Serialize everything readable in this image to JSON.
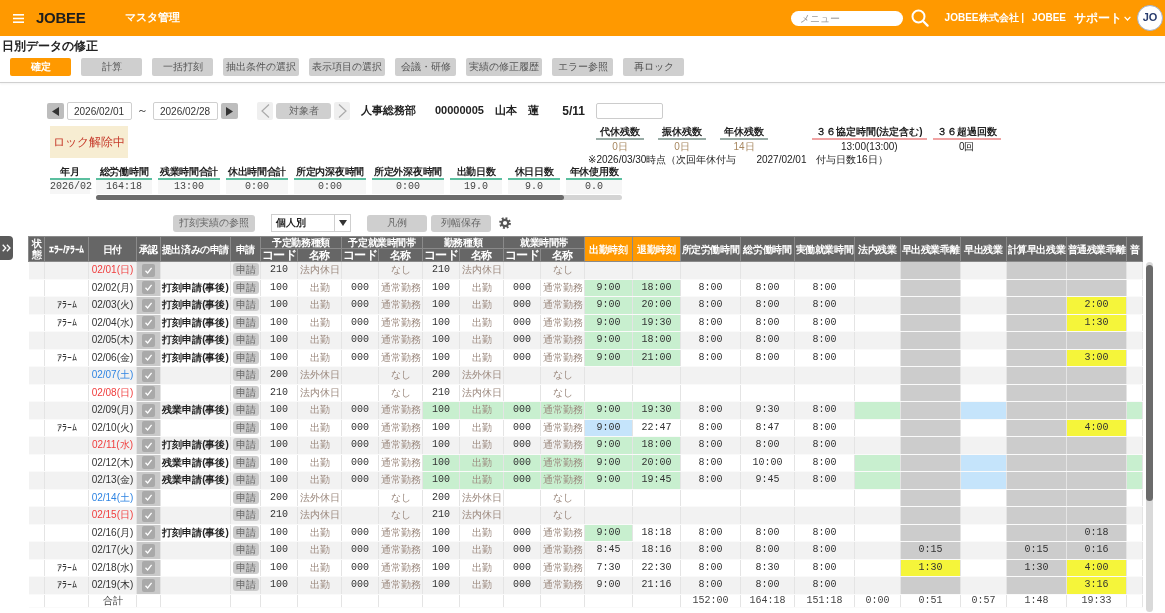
{
  "header": {
    "logo": "JOBEE",
    "section": "マスタ管理",
    "search": {
      "placeholder": "メニュー"
    },
    "company": "JOBEE株式会社 |",
    "user": "JOBEE",
    "support": "サポート",
    "avatar": "JO"
  },
  "page_title": "日別データの修正",
  "toolbar": [
    {
      "label": "確定",
      "kind": "primary"
    },
    {
      "label": "計算",
      "kind": "secondary"
    },
    {
      "label": "一括打刻",
      "kind": "secondary"
    },
    {
      "label": "抽出条件の選択",
      "kind": "secondary"
    },
    {
      "label": "表示項目の選択",
      "kind": "secondary"
    },
    {
      "label": "会議・研修",
      "kind": "secondary"
    },
    {
      "label": "実績の修正履歴",
      "kind": "secondary"
    },
    {
      "label": "エラー参照",
      "kind": "secondary"
    },
    {
      "label": "再ロック",
      "kind": "secondary"
    }
  ],
  "period": {
    "from": "2026/02/01",
    "separator": "～",
    "to": "2026/02/28"
  },
  "target": {
    "button": "対象者",
    "department": "人事総務部",
    "code": "00000005",
    "name": "山本　蓮",
    "position": "5/11"
  },
  "lock_status": "ロック解除中",
  "summary": [
    {
      "label": "年月",
      "value": "2026/02"
    },
    {
      "label": "総労働時間",
      "value": "164:18"
    },
    {
      "label": "残業時間合計",
      "value": "13:00"
    },
    {
      "label": "休出時間合計",
      "value": "0:00"
    },
    {
      "label": "所定内深夜時間",
      "value": "0:00"
    },
    {
      "label": "所定外深夜時間",
      "value": "0:00"
    },
    {
      "label": "出勤日数",
      "value": "19.0"
    },
    {
      "label": "休日日数",
      "value": "9.0"
    },
    {
      "label": "年休使用数",
      "value": "0.0"
    }
  ],
  "balances": {
    "items": [
      {
        "label": "代休残数",
        "value": "0日",
        "kind": "leave"
      },
      {
        "label": "振休残数",
        "value": "0日",
        "kind": "leave"
      },
      {
        "label": "年休残数",
        "value": "14日",
        "kind": "leave"
      },
      {
        "label": "３６協定時間(法定含む)",
        "value": "13:00(13:00)",
        "kind": "limit"
      },
      {
        "label": "３６超過回数",
        "value": "0回",
        "kind": "limit"
      }
    ],
    "note": "※2026/03/30時点（次回年休付与　　2027/02/01　付与日数16日）"
  },
  "table_tools": {
    "reference_button": "打刻実績の参照",
    "view_select": "個人別",
    "legend_button": "凡例",
    "save_widths_button": "列幅保存"
  },
  "table": {
    "columns": [
      {
        "label": "状態",
        "kind": "label"
      },
      {
        "label": "ｴﾗｰ/ｱﾗｰﾑ",
        "kind": "label"
      },
      {
        "label": "日付",
        "kind": "label"
      },
      {
        "label": "承認",
        "kind": "label"
      },
      {
        "label": "提出済みの申請",
        "kind": "label"
      },
      {
        "label": "申請",
        "kind": "label"
      },
      {
        "label": "予定勤務種類",
        "kind": "group",
        "subcolumns": [
          {
            "label": "コード",
            "kind": "code"
          },
          {
            "label": "名称",
            "kind": "name"
          }
        ]
      },
      {
        "label": "予定就業時間帯",
        "kind": "group",
        "subcolumns": [
          {
            "label": "コード",
            "kind": "code"
          },
          {
            "label": "名称",
            "kind": "name"
          }
        ]
      },
      {
        "label": "勤務種類",
        "kind": "group",
        "subcolumns": [
          {
            "label": "コード",
            "kind": "code"
          },
          {
            "label": "名称",
            "kind": "name"
          }
        ]
      },
      {
        "label": "就業時間帯",
        "kind": "group",
        "subcolumns": [
          {
            "label": "コード",
            "kind": "code"
          },
          {
            "label": "名称",
            "kind": "name"
          }
        ]
      },
      {
        "label": "出勤時刻",
        "kind": "time",
        "accent": true,
        "shaded": false
      },
      {
        "label": "退勤時刻",
        "kind": "time",
        "accent": true,
        "shaded": false
      },
      {
        "label": "所定労働時間",
        "kind": "time",
        "accent": false,
        "shaded": false
      },
      {
        "label": "総労働時間",
        "kind": "time",
        "accent": false,
        "shaded": false
      },
      {
        "label": "実働就業時間",
        "kind": "time",
        "accent": false,
        "shaded": false
      },
      {
        "label": "法内残業",
        "kind": "time",
        "accent": false,
        "shaded": false
      },
      {
        "label": "早出残業乖離",
        "kind": "time",
        "accent": false,
        "shaded": true
      },
      {
        "label": "早出残業",
        "kind": "time",
        "accent": false,
        "shaded": false
      },
      {
        "label": "計算早出残業",
        "kind": "time",
        "accent": false,
        "shaded": true
      },
      {
        "label": "普通残業乖離",
        "kind": "time",
        "accent": false,
        "shaded": true
      },
      {
        "label": "普",
        "kind": "time",
        "accent": false,
        "shaded": false
      }
    ],
    "rows": [
      {
        "kind": "holiday",
        "date": "02/01(日)",
        "approved": true,
        "apply": "申請",
        "planned_work_type": {
          "code": "210",
          "name": "法内休日"
        },
        "planned_work_hours": {
          "name": "なし"
        },
        "work_type": {
          "code": "210",
          "name": "法内休日"
        },
        "work_hours": {
          "name": "なし"
        }
      },
      {
        "kind": "weekday",
        "date": "02/02(月)",
        "approved": true,
        "request": "打刻申請(事後)",
        "apply": "申請",
        "planned_work_type": {
          "code": "100",
          "name": "出勤"
        },
        "planned_work_hours": {
          "code": "000",
          "name": "通常勤務"
        },
        "work_type": {
          "code": "100",
          "name": "出勤"
        },
        "work_hours": {
          "code": "000",
          "name": "通常勤務"
        },
        "clock_in": {
          "text": "9:00",
          "color": "#c8efcf"
        },
        "clock_out": {
          "text": "18:00",
          "color": "#c8efcf"
        },
        "scheduled_hours": "8:00",
        "total_hours": "8:00",
        "actual_hours": "8:00"
      },
      {
        "kind": "weekday",
        "alarm": "ｱﾗｰﾑ",
        "date": "02/03(火)",
        "approved": true,
        "request": "打刻申請(事後)",
        "apply": "申請",
        "planned_work_type": {
          "code": "100",
          "name": "出勤"
        },
        "planned_work_hours": {
          "code": "000",
          "name": "通常勤務"
        },
        "work_type": {
          "code": "100",
          "name": "出勤"
        },
        "work_hours": {
          "code": "000",
          "name": "通常勤務"
        },
        "clock_in": {
          "text": "9:00",
          "color": "#c8efcf"
        },
        "clock_out": {
          "text": "20:00",
          "color": "#c8efcf"
        },
        "scheduled_hours": "8:00",
        "total_hours": "8:00",
        "actual_hours": "8:00",
        "overtime_gap": {
          "text": "2:00",
          "color": "#f5f53a"
        }
      },
      {
        "kind": "weekday",
        "alarm": "ｱﾗｰﾑ",
        "date": "02/04(水)",
        "approved": true,
        "request": "打刻申請(事後)",
        "apply": "申請",
        "planned_work_type": {
          "code": "100",
          "name": "出勤"
        },
        "planned_work_hours": {
          "code": "000",
          "name": "通常勤務"
        },
        "work_type": {
          "code": "100",
          "name": "出勤"
        },
        "work_hours": {
          "code": "000",
          "name": "通常勤務"
        },
        "clock_in": {
          "text": "9:00",
          "color": "#c8efcf"
        },
        "clock_out": {
          "text": "19:30",
          "color": "#c8efcf"
        },
        "scheduled_hours": "8:00",
        "total_hours": "8:00",
        "actual_hours": "8:00",
        "overtime_gap": {
          "text": "1:30",
          "color": "#f5f53a"
        }
      },
      {
        "kind": "weekday",
        "date": "02/05(木)",
        "approved": true,
        "request": "打刻申請(事後)",
        "apply": "申請",
        "planned_work_type": {
          "code": "100",
          "name": "出勤"
        },
        "planned_work_hours": {
          "code": "000",
          "name": "通常勤務"
        },
        "work_type": {
          "code": "100",
          "name": "出勤"
        },
        "work_hours": {
          "code": "000",
          "name": "通常勤務"
        },
        "clock_in": {
          "text": "9:00",
          "color": "#c8efcf"
        },
        "clock_out": {
          "text": "18:00",
          "color": "#c8efcf"
        },
        "scheduled_hours": "8:00",
        "total_hours": "8:00",
        "actual_hours": "8:00"
      },
      {
        "kind": "weekday",
        "alarm": "ｱﾗｰﾑ",
        "date": "02/06(金)",
        "approved": true,
        "request": "打刻申請(事後)",
        "apply": "申請",
        "planned_work_type": {
          "code": "100",
          "name": "出勤"
        },
        "planned_work_hours": {
          "code": "000",
          "name": "通常勤務"
        },
        "work_type": {
          "code": "100",
          "name": "出勤"
        },
        "work_hours": {
          "code": "000",
          "name": "通常勤務"
        },
        "clock_in": {
          "text": "9:00",
          "color": "#c8efcf"
        },
        "clock_out": {
          "text": "21:00",
          "color": "#c8efcf"
        },
        "scheduled_hours": "8:00",
        "total_hours": "8:00",
        "actual_hours": "8:00",
        "overtime_gap": {
          "text": "3:00",
          "color": "#f5f53a"
        }
      },
      {
        "kind": "saturday",
        "date": "02/07(土)",
        "approved": true,
        "apply": "申請",
        "planned_work_type": {
          "code": "200",
          "name": "法外休日"
        },
        "planned_work_hours": {
          "name": "なし"
        },
        "work_type": {
          "code": "200",
          "name": "法外休日"
        },
        "work_hours": {
          "name": "なし"
        }
      },
      {
        "kind": "holiday",
        "date": "02/08(日)",
        "approved": true,
        "apply": "申請",
        "planned_work_type": {
          "code": "210",
          "name": "法内休日"
        },
        "planned_work_hours": {
          "name": "なし"
        },
        "work_type": {
          "code": "210",
          "name": "法内休日"
        },
        "work_hours": {
          "name": "なし"
        }
      },
      {
        "kind": "weekday",
        "date": "02/09(月)",
        "approved": true,
        "request": "残業申請(事後)",
        "apply": "申請",
        "planned_work_type": {
          "code": "100",
          "name": "出勤"
        },
        "planned_work_hours": {
          "code": "000",
          "name": "通常勤務"
        },
        "work_type": {
          "code": {
            "text": "100",
            "color": "#c8efcf"
          },
          "name": {
            "text": "出勤",
            "color": "#c8efcf"
          }
        },
        "work_hours": {
          "code": {
            "text": "000",
            "color": "#c8efcf"
          },
          "name": {
            "text": "通常勤務",
            "color": "#c8efcf"
          }
        },
        "clock_in": {
          "text": "9:00",
          "color": "#c8efcf"
        },
        "clock_out": {
          "text": "19:30",
          "color": "#c8efcf"
        },
        "scheduled_hours": "8:00",
        "total_hours": "9:30",
        "actual_hours": "8:00",
        "statutory_overtime": {
          "color": "#c8efcf"
        },
        "early_overtime": {
          "color": "#c5e4fb"
        },
        "column_25": {
          "color": "#c8efcf"
        }
      },
      {
        "kind": "weekday",
        "alarm": "ｱﾗｰﾑ",
        "date": "02/10(火)",
        "approved": true,
        "apply": "申請",
        "planned_work_type": {
          "code": "100",
          "name": "出勤"
        },
        "planned_work_hours": {
          "code": "000",
          "name": "通常勤務"
        },
        "work_type": {
          "code": "100",
          "name": "出勤"
        },
        "work_hours": {
          "code": "000",
          "name": "通常勤務"
        },
        "clock_in": {
          "text": "9:00",
          "color": "#c5e4fb"
        },
        "clock_out": "22:47",
        "scheduled_hours": "8:00",
        "total_hours": "8:47",
        "actual_hours": "8:00",
        "overtime_gap": {
          "text": "4:00",
          "color": "#f5f53a"
        }
      },
      {
        "kind": "holiday",
        "date": "02/11(水)",
        "approved": true,
        "request": "打刻申請(事後)",
        "apply": "申請",
        "planned_work_type": {
          "code": "100",
          "name": "出勤"
        },
        "planned_work_hours": {
          "code": "000",
          "name": "通常勤務"
        },
        "work_type": {
          "code": "100",
          "name": "出勤"
        },
        "work_hours": {
          "code": "000",
          "name": "通常勤務"
        },
        "clock_in": {
          "text": "9:00",
          "color": "#c8efcf"
        },
        "clock_out": {
          "text": "18:00",
          "color": "#c8efcf"
        },
        "scheduled_hours": "8:00",
        "total_hours": "8:00",
        "actual_hours": "8:00"
      },
      {
        "kind": "weekday",
        "date": "02/12(木)",
        "approved": true,
        "request": "残業申請(事後)",
        "apply": "申請",
        "planned_work_type": {
          "code": "100",
          "name": "出勤"
        },
        "planned_work_hours": {
          "code": "000",
          "name": "通常勤務"
        },
        "work_type": {
          "code": {
            "text": "100",
            "color": "#c8efcf"
          },
          "name": {
            "text": "出勤",
            "color": "#c8efcf"
          }
        },
        "work_hours": {
          "code": {
            "text": "000",
            "color": "#c8efcf"
          },
          "name": {
            "text": "通常勤務",
            "color": "#c8efcf"
          }
        },
        "clock_in": {
          "text": "9:00",
          "color": "#c8efcf"
        },
        "clock_out": {
          "text": "20:00",
          "color": "#c8efcf"
        },
        "scheduled_hours": "8:00",
        "total_hours": "10:00",
        "actual_hours": "8:00",
        "statutory_overtime": {
          "color": "#c8efcf"
        },
        "early_overtime": {
          "color": "#c5e4fb"
        },
        "column_25": {
          "color": "#c8efcf"
        }
      },
      {
        "kind": "weekday",
        "date": "02/13(金)",
        "approved": true,
        "request": "残業申請(事後)",
        "apply": "申請",
        "planned_work_type": {
          "code": "100",
          "name": "出勤"
        },
        "planned_work_hours": {
          "code": "000",
          "name": "通常勤務"
        },
        "work_type": {
          "code": {
            "text": "100",
            "color": "#c8efcf"
          },
          "name": {
            "text": "出勤",
            "color": "#c8efcf"
          }
        },
        "work_hours": {
          "code": {
            "text": "000",
            "color": "#c8efcf"
          },
          "name": {
            "text": "通常勤務",
            "color": "#c8efcf"
          }
        },
        "clock_in": {
          "text": "9:00",
          "color": "#c8efcf"
        },
        "clock_out": {
          "text": "19:45",
          "color": "#c8efcf"
        },
        "scheduled_hours": "8:00",
        "total_hours": "9:45",
        "actual_hours": "8:00",
        "statutory_overtime": {
          "color": "#c8efcf"
        },
        "early_overtime": {
          "color": "#c5e4fb"
        },
        "column_25": {
          "color": "#c8efcf"
        }
      },
      {
        "kind": "saturday",
        "date": "02/14(土)",
        "approved": true,
        "apply": "申請",
        "planned_work_type": {
          "code": "200",
          "name": "法外休日"
        },
        "planned_work_hours": {
          "name": "なし"
        },
        "work_type": {
          "code": "200",
          "name": "法外休日"
        },
        "work_hours": {
          "name": "なし"
        }
      },
      {
        "kind": "holiday",
        "date": "02/15(日)",
        "approved": true,
        "apply": "申請",
        "planned_work_type": {
          "code": "210",
          "name": "法内休日"
        },
        "planned_work_hours": {
          "name": "なし"
        },
        "work_type": {
          "code": "210",
          "name": "法内休日"
        },
        "work_hours": {
          "name": "なし"
        }
      },
      {
        "kind": "weekday",
        "date": "02/16(月)",
        "approved": true,
        "request": "打刻申請(事後)",
        "apply": "申請",
        "planned_work_type": {
          "code": "100",
          "name": "出勤"
        },
        "planned_work_hours": {
          "code": "000",
          "name": "通常勤務"
        },
        "work_type": {
          "code": "100",
          "name": "出勤"
        },
        "work_hours": {
          "code": "000",
          "name": "通常勤務"
        },
        "clock_in": {
          "text": "9:00",
          "color": "#c8efcf"
        },
        "clock_out": "18:18",
        "scheduled_hours": "8:00",
        "total_hours": "8:00",
        "actual_hours": "8:00",
        "overtime_gap": "0:18"
      },
      {
        "kind": "weekday",
        "date": "02/17(火)",
        "approved": true,
        "apply": "申請",
        "planned_work_type": {
          "code": "100",
          "name": "出勤"
        },
        "planned_work_hours": {
          "code": "000",
          "name": "通常勤務"
        },
        "work_type": {
          "code": "100",
          "name": "出勤"
        },
        "work_hours": {
          "code": "000",
          "name": "通常勤務"
        },
        "clock_in": "8:45",
        "clock_out": "18:16",
        "scheduled_hours": "8:00",
        "total_hours": "8:00",
        "actual_hours": "8:00",
        "early_overtime_gap": "0:15",
        "calculated_early_overtime": "0:15",
        "overtime_gap": "0:16"
      },
      {
        "kind": "weekday",
        "alarm": "ｱﾗｰﾑ",
        "date": "02/18(水)",
        "approved": true,
        "apply": "申請",
        "planned_work_type": {
          "code": "100",
          "name": "出勤"
        },
        "planned_work_hours": {
          "code": "000",
          "name": "通常勤務"
        },
        "work_type": {
          "code": "100",
          "name": "出勤"
        },
        "work_hours": {
          "code": "000",
          "name": "通常勤務"
        },
        "clock_in": "7:30",
        "clock_out": "22:30",
        "scheduled_hours": "8:00",
        "total_hours": "8:30",
        "actual_hours": "8:00",
        "early_overtime_gap": {
          "text": "1:30",
          "color": "#f5f53a"
        },
        "calculated_early_overtime": "1:30",
        "overtime_gap": {
          "text": "4:00",
          "color": "#f5f53a"
        }
      },
      {
        "kind": "weekday",
        "alarm": "ｱﾗｰﾑ",
        "date": "02/19(木)",
        "approved": true,
        "apply": "申請",
        "planned_work_type": {
          "code": "100",
          "name": "出勤"
        },
        "planned_work_hours": {
          "code": "000",
          "name": "通常勤務"
        },
        "work_type": {
          "code": "100",
          "name": "出勤"
        },
        "work_hours": {
          "code": "000",
          "name": "通常勤務"
        },
        "clock_in": "9:00",
        "clock_out": "21:16",
        "scheduled_hours": "8:00",
        "total_hours": "8:00",
        "actual_hours": "8:00",
        "overtime_gap": {
          "text": "3:16",
          "color": "#f5f53a"
        }
      }
    ],
    "total": {
      "label": "合計",
      "scheduled_hours": "152:00",
      "total_hours": "164:18",
      "actual_hours": "151:18",
      "statutory_overtime": "0:00",
      "early_overtime_gap": "0:51",
      "early_overtime": "0:57",
      "calculated_early_overtime": "1:48",
      "overtime_gap": "19:33"
    }
  }
}
